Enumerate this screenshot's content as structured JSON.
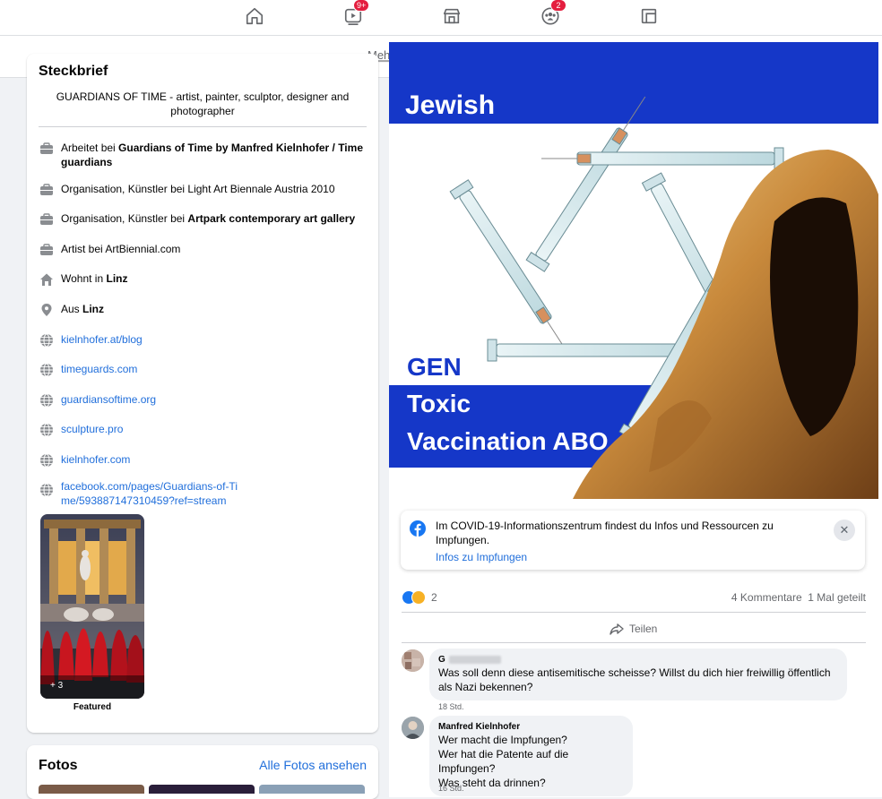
{
  "nav": {
    "watch_badge": "9+",
    "groups_badge": "2"
  },
  "subnav": {
    "more_label": "Meh"
  },
  "intro": {
    "title": "Steckbrief",
    "bio": "GUARDIANS OF TIME - artist, painter, sculptor, designer and photographer",
    "items": [
      {
        "icon": "briefcase-icon",
        "prefix": "Arbeitet bei ",
        "bold": "Guardians of Time by Manfred Kielnhofer / Time guardians"
      },
      {
        "icon": "briefcase-icon",
        "prefix": "Organisation, Künstler bei Light Art Biennale Austria 2010",
        "bold": ""
      },
      {
        "icon": "briefcase-icon",
        "prefix": "Organisation, Künstler bei ",
        "bold": "Artpark contemporary art gallery"
      },
      {
        "icon": "briefcase-icon",
        "prefix": "Artist bei ArtBiennial.com",
        "bold": ""
      },
      {
        "icon": "home-icon",
        "prefix": "Wohnt in ",
        "bold": "Linz"
      },
      {
        "icon": "location-pin-icon",
        "prefix": "Aus ",
        "bold": "Linz"
      }
    ],
    "links": [
      "kielnhofer.at/blog",
      "timeguards.com",
      "guardiansoftime.org",
      "sculpture.pro",
      "kielnhofer.com",
      "facebook.com/pages/Guardians-of-Time/593887147310459?ref=stream"
    ],
    "featured_count": "+ 3",
    "featured_label": "Featured"
  },
  "fotos": {
    "title": "Fotos",
    "all_link": "Alle Fotos ansehen"
  },
  "post": {
    "image_text": {
      "top": "Jewish",
      "line1": "GEN",
      "line2": "Toxic",
      "line3": "Vaccination ABO"
    },
    "covid_notice": {
      "text": "Im COVID-19-Informationszentrum findest du Infos und Ressourcen zu Impfungen.",
      "link": "Infos zu Impfungen"
    },
    "reaction_count": "2",
    "comments_count": "4 Kommentare",
    "shares_count": "1 Mal geteilt",
    "share_label": "Teilen",
    "comments": [
      {
        "author": "G",
        "text": "Was soll denn diese antisemitische scheisse? Willst du dich hier freiwillig öffentlich als Nazi bekennen?",
        "time": "18 Std."
      },
      {
        "author": "Manfred Kielnhofer",
        "text_lines": [
          "Wer macht die Impfungen?",
          "Wer hat die Patente auf die Impfungen?",
          "Was steht da drinnen?"
        ],
        "time": "16 Std."
      }
    ]
  },
  "colors": {
    "link": "#216fdb",
    "flag_blue": "#1537c8",
    "badge": "#e41e3f"
  }
}
